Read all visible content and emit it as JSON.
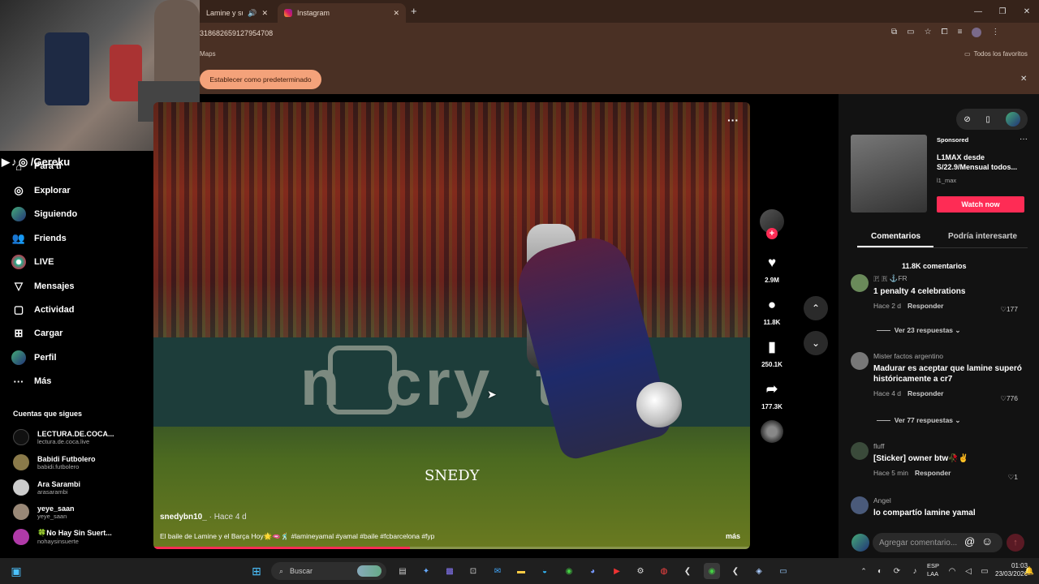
{
  "browser": {
    "tabs": [
      {
        "label": "Lamine y su celebración",
        "active": false
      },
      {
        "label": "Instagram",
        "active": true
      }
    ],
    "address": "31868265912795470​8",
    "bookmark": "Maps",
    "favorites": "Todos los favoritos",
    "infobar_button": "Establecer como predeterminado"
  },
  "overlay_name": "▶ ♪ ◎ /Gereku",
  "sidebar": {
    "items": [
      {
        "label": "Para ti",
        "icon": "home-icon"
      },
      {
        "label": "Explorar",
        "icon": "compass-icon"
      },
      {
        "label": "Siguiendo",
        "icon": "following-icon"
      },
      {
        "label": "Friends",
        "icon": "friends-icon"
      },
      {
        "label": "LIVE",
        "icon": "live-icon"
      },
      {
        "label": "Mensajes",
        "icon": "messages-icon"
      },
      {
        "label": "Actividad",
        "icon": "activity-icon"
      },
      {
        "label": "Cargar",
        "icon": "upload-icon"
      },
      {
        "label": "Perfil",
        "icon": "profile-icon"
      },
      {
        "label": "Más",
        "icon": "more-icon"
      }
    ],
    "following_title": "Cuentas que sigues",
    "accounts": [
      {
        "name": "LECTURA.DE.COCA...",
        "handle": "lectura.de.coca.live"
      },
      {
        "name": "Babidi Futbolero",
        "handle": "babidi.futbolero"
      },
      {
        "name": "Ara Sarambi",
        "handle": "arasarambi"
      },
      {
        "name": "yeye_saan",
        "handle": "yeye_saan"
      },
      {
        "name": "🍀No Hay Sin Suert...",
        "handle": "nohaysinsuerte"
      }
    ]
  },
  "video": {
    "author": "snedybn10_",
    "time": " · Hace 4 d",
    "caption": "El baile de Lamine y el Barça Hoy🌟🫦🕺 #lamineyamal #yamal #baile #fcbarcelona #fyp",
    "more": "más",
    "watermark": "SNEDY",
    "board_text": "n  cry  to",
    "progress": 0.43
  },
  "actions": {
    "likes": "2.9M",
    "comments": "11.8K",
    "saves": "250.1K",
    "shares": "177.3K"
  },
  "ad": {
    "sponsored": "Sponsored",
    "title": "L1MAX desde S/22.9/Mensual todos...",
    "handle": "l1_max",
    "cta": "Watch now"
  },
  "comments_panel": {
    "tab_comments": "Comentarios",
    "tab_interest": "Podría interesarte",
    "count": "11.8K comentarios",
    "items": [
      {
        "user": "🇵 🇷 ⚓FR",
        "text": "1 penalty 4 celebrations",
        "time": "Hace 2 d",
        "reply": "Responder",
        "likes": "177",
        "more": "Ver 23 respuestas"
      },
      {
        "user": "Mister factos argentino",
        "text": "Madurar es aceptar que lamine superó históricamente a cr7",
        "time": "Hace 4 d",
        "reply": "Responder",
        "likes": "776",
        "more": "Ver 77 respuestas"
      },
      {
        "user": "fluff",
        "text": "[Sticker] owner btw🥀✌",
        "time": "Hace 5 min",
        "reply": "Responder",
        "likes": "1",
        "more": ""
      },
      {
        "user": "Angel",
        "text": "lo compartío lamine yamal",
        "time": "",
        "reply": "",
        "likes": "",
        "more": ""
      }
    ],
    "input_placeholder": "Agregar comentario..."
  },
  "taskbar": {
    "search": "Buscar",
    "lang1": "ESP",
    "lang2": "LAA",
    "time": "01:03",
    "date": "23/03/2026"
  }
}
